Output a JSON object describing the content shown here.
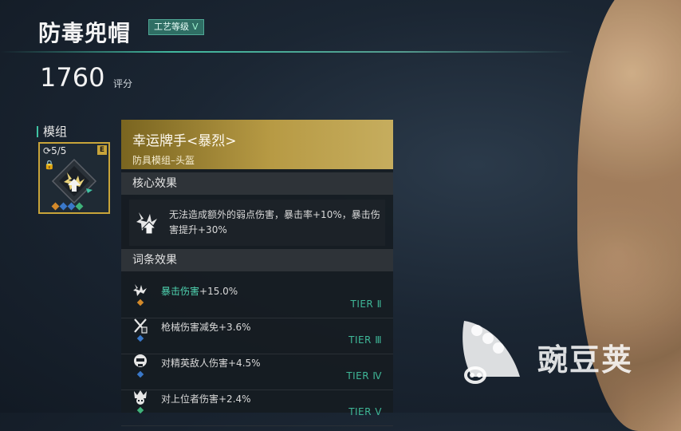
{
  "item": {
    "name": "防毒兜帽",
    "craft_label": "工艺等级",
    "craft_level": "V",
    "score": "1760",
    "score_label": "评分"
  },
  "module_section": {
    "label": "模组",
    "capacity": "5/5",
    "rarity": "E",
    "gem_colors": [
      "#d48a2a",
      "#3a78c9",
      "#3a78c9",
      "#3fb27a"
    ]
  },
  "module_detail": {
    "name": "幸运牌手<暴烈>",
    "subtitle": "防具模组–头盔",
    "core_header": "核心效果",
    "core_text": "无法造成额外的弱点伤害，暴击率+10%，暴击伤害提升+30%",
    "affix_header": "词条效果",
    "affixes": [
      {
        "highlight": "暴击伤害",
        "rest": "+15.0%",
        "tier": "TIER Ⅱ",
        "icon": "explosion-icon",
        "dot_color": "#d48a2a"
      },
      {
        "highlight": "",
        "rest": "枪械伤害减免+3.6%",
        "tier": "TIER Ⅲ",
        "icon": "crossed-guns-icon",
        "dot_color": "#3a78c9"
      },
      {
        "highlight": "",
        "rest": "对精英敌人伤害+4.5%",
        "tier": "TIER Ⅳ",
        "icon": "elite-skull-icon",
        "dot_color": "#3a78c9"
      },
      {
        "highlight": "",
        "rest": "对上位者伤害+2.4%",
        "tier": "TIER Ⅴ",
        "icon": "boss-skull-icon",
        "dot_color": "#3fb27a"
      }
    ]
  },
  "watermark": {
    "text": "豌豆荚"
  }
}
